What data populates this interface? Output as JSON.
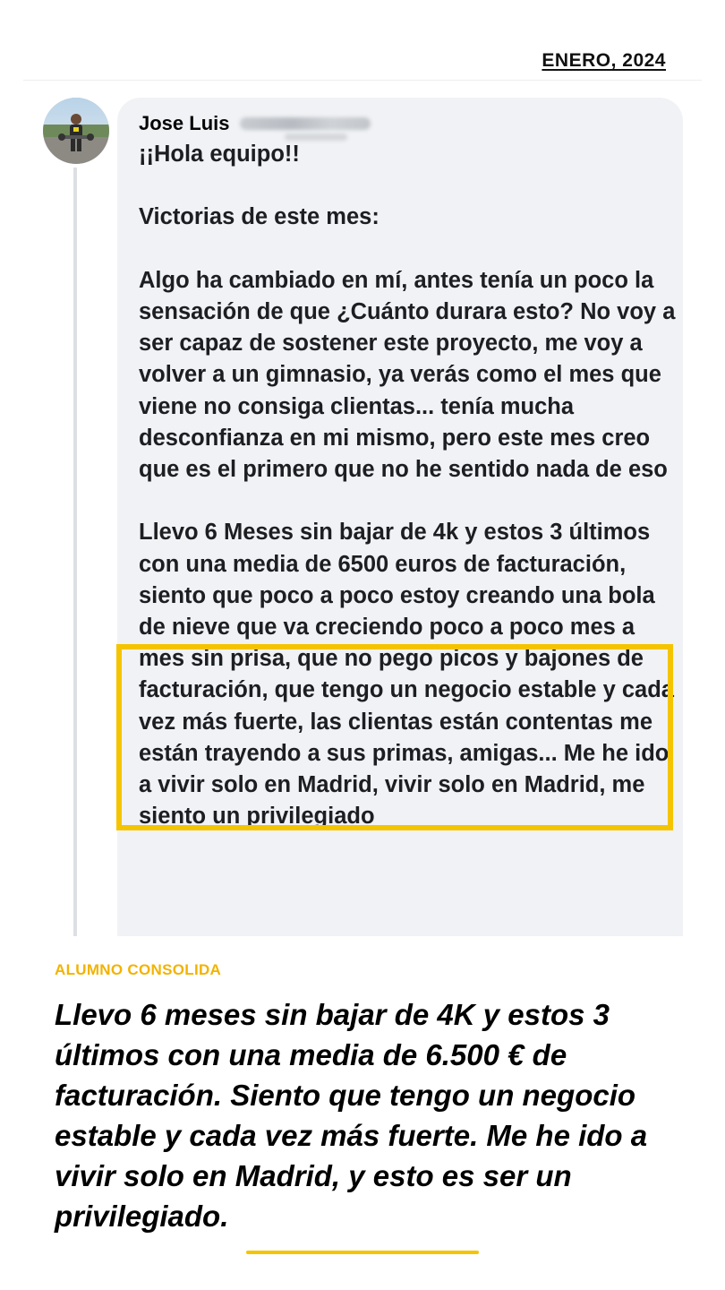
{
  "header": {
    "date": "ENERO, 2024"
  },
  "comment": {
    "author": "Jose Luis",
    "paragraphs": [
      "¡¡Hola equipo!!",
      "Victorias de este mes:",
      "Algo ha cambiado en mí, antes tenía un poco la sensación de que ¿Cuánto durara esto? No voy a ser capaz de sostener este proyecto, me voy a volver a un gimnasio, ya verás como el mes que viene no consiga clientas... tenía mucha desconfianza en mi mismo, pero este mes creo que es el primero que no he sentido nada de eso",
      "Llevo 6 Meses sin bajar de 4k y estos 3 últimos con una media de 6500 euros de facturación, siento que poco a poco estoy creando una bola de nieve que va creciendo poco a poco mes a mes sin prisa, que no pego picos y bajones de facturación, que tengo un negocio estable y cada vez más fuerte, las clientas están contentas me están trayendo a sus primas, amigas... Me he ido a vivir solo en Madrid, vivir solo en Madrid, me siento un privilegiado"
    ]
  },
  "testimonial": {
    "label": "ALUMNO CONSOLIDA",
    "quote": "Llevo 6 meses sin bajar de 4K y estos 3 últimos con una media de 6.500 € de facturación. Siento que tengo un negocio estable y cada vez más fuerte. Me he ido a vivir solo en Madrid, y esto es ser un privilegiado."
  },
  "colors": {
    "accent": "#f5c400",
    "label": "#f2b300",
    "bubble": "#f0f2f5"
  },
  "icons": {
    "avatar": "user-photo"
  }
}
